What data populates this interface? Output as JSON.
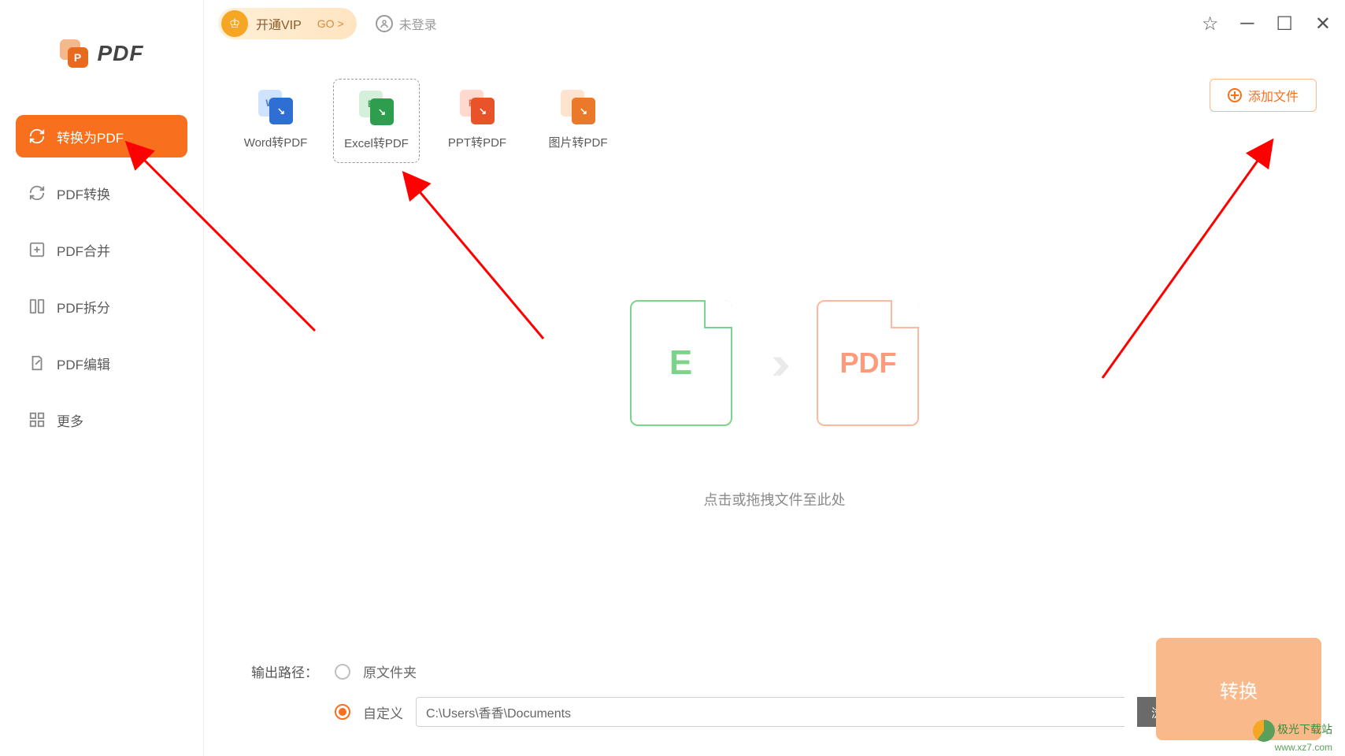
{
  "logo": {
    "text": "PDF"
  },
  "sidebar": {
    "items": [
      {
        "label": "转换为PDF"
      },
      {
        "label": "PDF转换"
      },
      {
        "label": "PDF合并"
      },
      {
        "label": "PDF拆分"
      },
      {
        "label": "PDF编辑"
      },
      {
        "label": "更多"
      }
    ]
  },
  "topbar": {
    "vip_label": "开通VIP",
    "vip_go": "GO >",
    "login_label": "未登录"
  },
  "tiles": [
    {
      "label": "Word转PDF",
      "back_letter": "W",
      "front_glyph": "↘"
    },
    {
      "label": "Excel转PDF",
      "back_letter": "E",
      "front_glyph": "↘"
    },
    {
      "label": "PPT转PDF",
      "back_letter": "P",
      "front_glyph": "↘"
    },
    {
      "label": "图片转PDF",
      "back_letter": "",
      "front_glyph": "↘"
    }
  ],
  "add_file_label": "添加文件",
  "drop": {
    "from_letter": "E",
    "to_letter": "PDF",
    "hint": "点击或拖拽文件至此处"
  },
  "footer": {
    "output_label": "输出路径：",
    "radio_original": "原文件夹",
    "radio_custom": "自定义",
    "path_value": "C:\\Users\\香香\\Documents",
    "browse_label": "浏览",
    "convert_label": "转换"
  },
  "watermark": {
    "name": "极光下载站",
    "url": "www.xz7.com"
  }
}
